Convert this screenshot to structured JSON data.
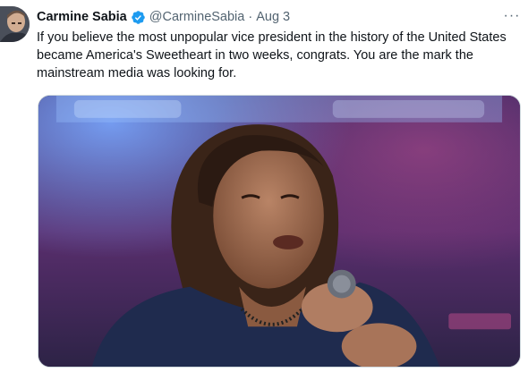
{
  "tweet": {
    "author_name": "Carmine Sabia",
    "handle": "@CarmineSabia",
    "separator": "·",
    "date": "Aug 3",
    "more_label": "···",
    "text": "If you believe the most unpopular vice president in the history of the United States became America's Sweetheart in two weeks, congrats. You are the mark the mainstream media was looking for.",
    "verified_color": "#1d9bf0",
    "media": {
      "icon": "photo"
    }
  }
}
